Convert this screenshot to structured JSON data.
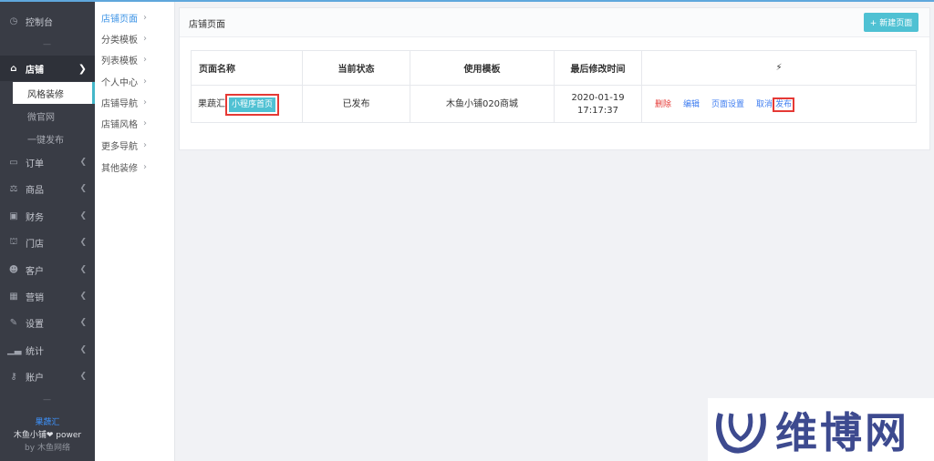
{
  "sidebar": {
    "dashboard": {
      "icon": "dashboard-icon",
      "label": "控制台"
    },
    "store": {
      "icon": "store-icon",
      "label": "店铺"
    },
    "store_sub": [
      {
        "label": "风格装修",
        "active": true
      },
      {
        "label": "微官网",
        "active": false
      },
      {
        "label": "一键发布",
        "active": false
      }
    ],
    "items": [
      {
        "icon": "order-icon",
        "label": "订单"
      },
      {
        "icon": "goods-icon",
        "label": "商品"
      },
      {
        "icon": "finance-icon",
        "label": "财务"
      },
      {
        "icon": "outlet-icon",
        "label": "门店"
      },
      {
        "icon": "customer-icon",
        "label": "客户"
      },
      {
        "icon": "marketing-icon",
        "label": "营销"
      },
      {
        "icon": "settings-icon",
        "label": "设置"
      },
      {
        "icon": "stats-icon",
        "label": "统计"
      },
      {
        "icon": "account-icon",
        "label": "账户"
      }
    ],
    "footer": {
      "brand": "果蔬汇",
      "power": "木鱼小铺❤ power",
      "by": "by 木鱼网络"
    }
  },
  "subnav": [
    {
      "label": "店铺页面",
      "active": true
    },
    {
      "label": "分类模板",
      "active": false
    },
    {
      "label": "列表模板",
      "active": false
    },
    {
      "label": "个人中心",
      "active": false
    },
    {
      "label": "店铺导航",
      "active": false
    },
    {
      "label": "店铺风格",
      "active": false
    },
    {
      "label": "更多导航",
      "active": false
    },
    {
      "label": "其他装修",
      "active": false
    }
  ],
  "main": {
    "title": "店铺页面",
    "new_button": "+ 新建页面",
    "table": {
      "headers": [
        "页面名称",
        "当前状态",
        "使用模板",
        "最后修改时间",
        "⚡"
      ],
      "row": {
        "name": "果蔬汇",
        "tag": "小程序首页",
        "status": "已发布",
        "template": "木鱼小铺020商城",
        "date": "2020-01-19",
        "time": "17:17:37",
        "actions": {
          "delete": "删除",
          "edit": "编辑",
          "settings": "页面设置",
          "cancel": "取消",
          "publish": "发布"
        }
      }
    }
  },
  "watermark": {
    "text": "维博网"
  },
  "colors": {
    "sidebar": "#393c45",
    "accent": "#4fc1d3",
    "link": "#3e7cf0",
    "danger": "#e53935",
    "highlight_box": "#e53935"
  }
}
